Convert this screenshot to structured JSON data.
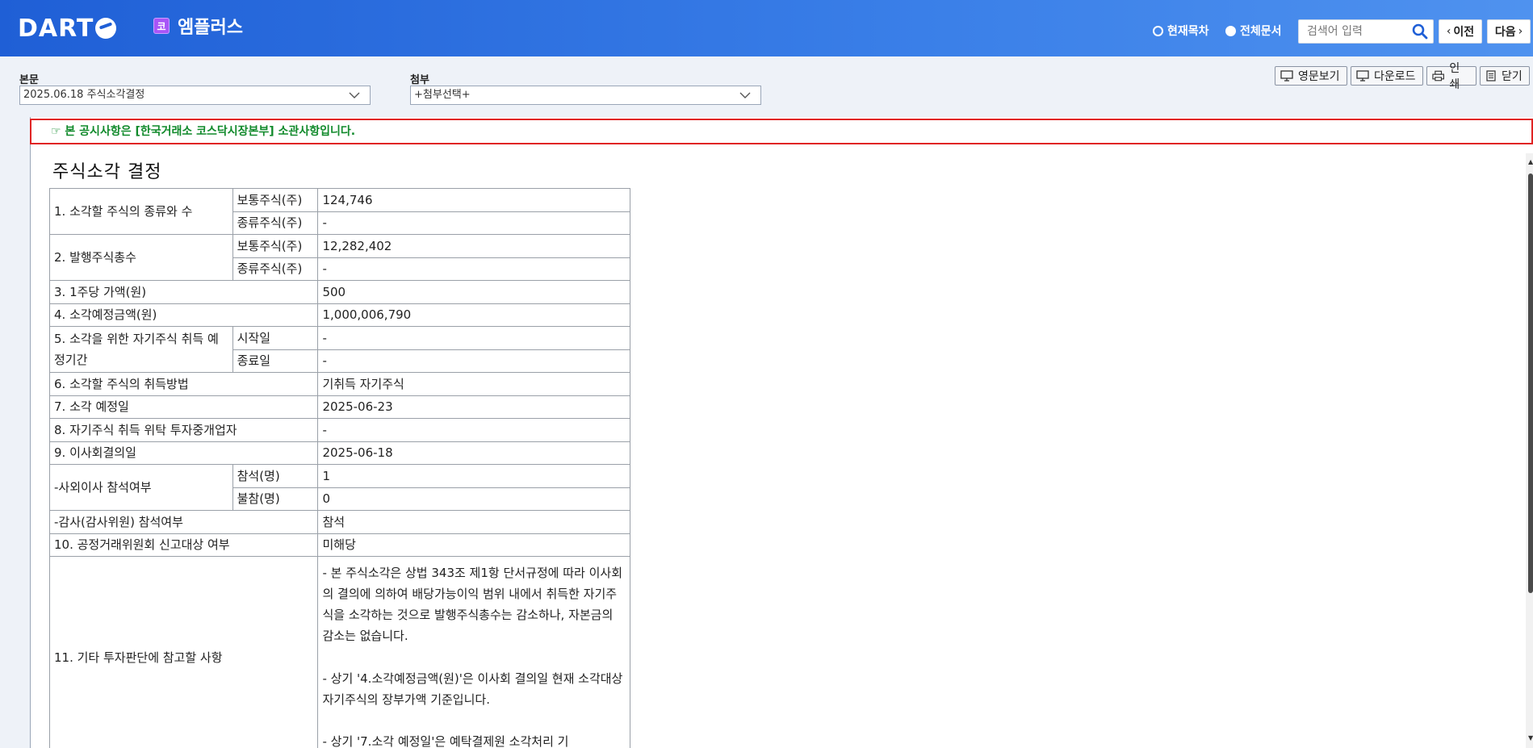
{
  "header": {
    "logo": "DART",
    "company_badge": "코",
    "company_name": "엠플러스",
    "radio_current": "현재목차",
    "radio_all": "전체문서",
    "search_placeholder": "검색어 입력",
    "prev": "이전",
    "next": "다음"
  },
  "selectors": {
    "main_label": "본문",
    "main_value": "2025.06.18  주식소각결정",
    "attach_label": "첨부",
    "attach_value": "+첨부선택+"
  },
  "toolbar": {
    "english": "영문보기",
    "download": "다운로드",
    "print": "인쇄",
    "close": "닫기"
  },
  "notice": "☞ 본 공시사항은 [한국거래소 코스닥시장본부] 소관사항입니다.",
  "document": {
    "title": "주식소각 결정",
    "rows": {
      "r1_label": "1. 소각할 주식의 종류와 수",
      "r1_common_label": "보통주식(주)",
      "r1_common_value": "124,746",
      "r1_pref_label": "종류주식(주)",
      "r1_pref_value": "-",
      "r2_label": "2. 발행주식총수",
      "r2_common_label": "보통주식(주)",
      "r2_common_value": "12,282,402",
      "r2_pref_label": "종류주식(주)",
      "r2_pref_value": "-",
      "r3_label": "3. 1주당 가액(원)",
      "r3_value": "500",
      "r4_label": "4. 소각예정금액(원)",
      "r4_value": "1,000,006,790",
      "r5_label": "5. 소각을 위한 자기주식 취득 예정기간",
      "r5_start_label": "시작일",
      "r5_start_value": "-",
      "r5_end_label": "종료일",
      "r5_end_value": "-",
      "r6_label": "6. 소각할 주식의 취득방법",
      "r6_value": "기취득 자기주식",
      "r7_label": "7. 소각 예정일",
      "r7_value": "2025-06-23",
      "r8_label": "8. 자기주식 취득 위탁 투자중개업자",
      "r8_value": "-",
      "r9_label": "9. 이사회결의일",
      "r9_value": "2025-06-18",
      "r9a_label": "-사외이사 참석여부",
      "r9a_present_label": "참석(명)",
      "r9a_present_value": "1",
      "r9a_absent_label": "불참(명)",
      "r9a_absent_value": "0",
      "r9b_label": "-감사(감사위원) 참석여부",
      "r9b_value": "참석",
      "r10_label": "10. 공정거래위원회 신고대상 여부",
      "r10_value": "미해당",
      "r11_label": "11. 기타 투자판단에 참고할 사항",
      "r11_p1": "- 본 주식소각은 상법 343조 제1항 단서규정에 따라 이사회의 결의에 의하여 배당가능이익 범위 내에서 취득한 자기주식을 소각하는 것으로 발행주식총수는 감소하나, 자본금의 감소는 없습니다.",
      "r11_p2": "- 상기 '4.소각예정금액(원)'은 이사회 결의일 현재 소각대상 자기주식의 장부가액 기준입니다.",
      "r11_p3": "- 상기 '7.소각 예정일'은 예탁결제원 소각처리 기"
    }
  }
}
